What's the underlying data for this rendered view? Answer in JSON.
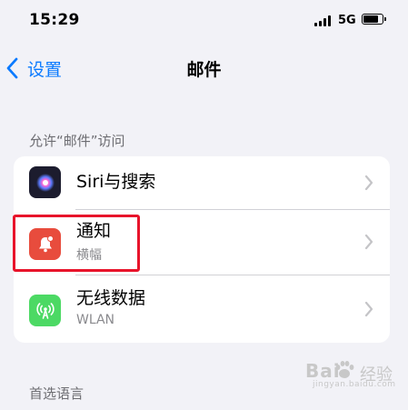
{
  "status_bar": {
    "time": "15:29",
    "network": "5G",
    "battery_level": 0.85
  },
  "nav": {
    "back_label": "设置",
    "title": "邮件"
  },
  "sections": [
    {
      "header": "允许“邮件”访问",
      "rows": [
        {
          "title": "Siri与搜索",
          "subtitle": "",
          "icon": "siri-icon",
          "icon_bg": "#1c1c2e"
        },
        {
          "title": "通知",
          "subtitle": "横幅",
          "icon": "notification-bell-icon",
          "icon_bg": "#e84c3d"
        },
        {
          "title": "无线数据",
          "subtitle": "WLAN",
          "icon": "cellular-antenna-icon",
          "icon_bg": "#4cd964"
        }
      ]
    },
    {
      "header": "首选语言"
    }
  ],
  "highlight_color": "#e8142b",
  "accent_color": "#0a7aff",
  "watermark": {
    "logo": "Bai",
    "text": "经验",
    "url": "jingyan.baidu.com"
  }
}
